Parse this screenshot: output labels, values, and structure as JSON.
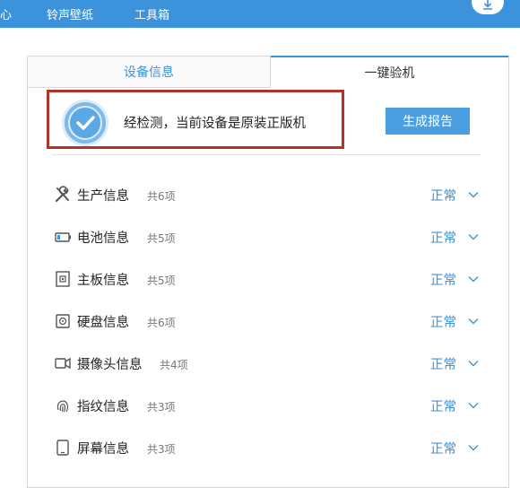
{
  "topnav": {
    "items": [
      "心",
      "铃声壁纸",
      "工具箱"
    ]
  },
  "tabs": {
    "device_info": "设备信息",
    "one_key_check": "一键验机"
  },
  "verdict": {
    "text": "经检测，当前设备是原装正版机",
    "report_button": "生成报告"
  },
  "sections": [
    {
      "label": "生产信息",
      "count": "共6项",
      "status": "正常",
      "icon": "tools-icon"
    },
    {
      "label": "电池信息",
      "count": "共5项",
      "status": "正常",
      "icon": "battery-icon"
    },
    {
      "label": "主板信息",
      "count": "共5项",
      "status": "正常",
      "icon": "board-icon"
    },
    {
      "label": "硬盘信息",
      "count": "共6项",
      "status": "正常",
      "icon": "disk-icon"
    },
    {
      "label": "摄像头信息",
      "count": "共4项",
      "status": "正常",
      "icon": "camera-icon"
    },
    {
      "label": "指纹信息",
      "count": "共3项",
      "status": "正常",
      "icon": "fingerprint-icon"
    },
    {
      "label": "屏幕信息",
      "count": "共3项",
      "status": "正常",
      "icon": "screen-icon"
    }
  ],
  "colors": {
    "accent": "#3d92dc",
    "highlight_border": "#b1332a"
  }
}
